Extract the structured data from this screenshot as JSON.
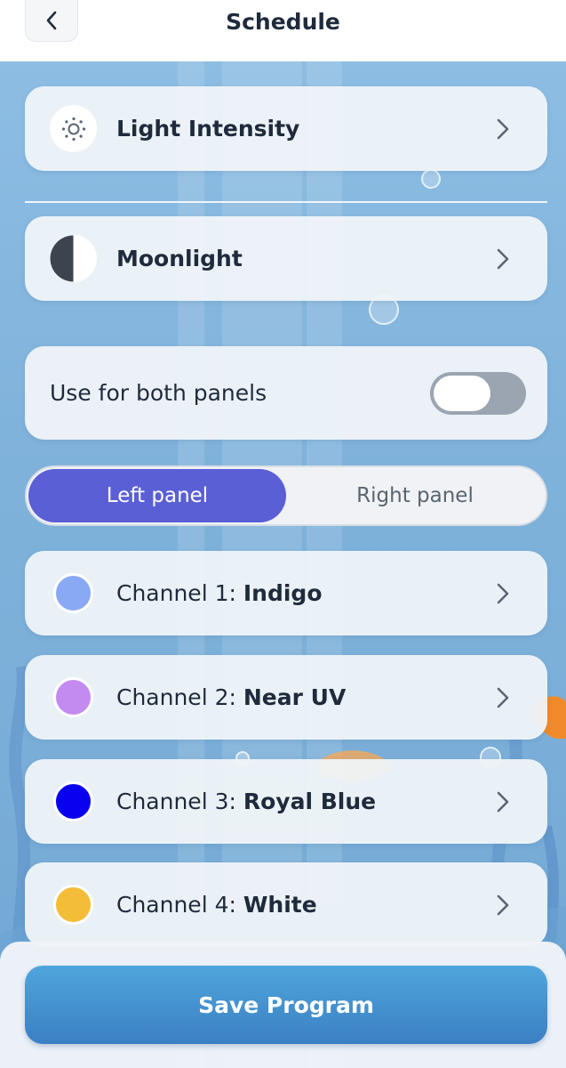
{
  "header": {
    "title": "Schedule",
    "back_icon": "chevron-left-icon"
  },
  "settings": {
    "light_intensity": {
      "label": "Light Intensity",
      "icon": "sun-icon"
    },
    "moonlight": {
      "label": "Moonlight",
      "icon": "half-moon-icon"
    },
    "use_both_panels": {
      "label": "Use for both panels",
      "enabled": false
    }
  },
  "panels": {
    "options": [
      "Left panel",
      "Right panel"
    ],
    "selected": "Left panel"
  },
  "channels": [
    {
      "prefix": "Channel 1: ",
      "name": "Indigo",
      "color": "#8aa9f5"
    },
    {
      "prefix": "Channel 2: ",
      "name": "Near UV",
      "color": "#c38af0"
    },
    {
      "prefix": "Channel 3: ",
      "name": "Royal Blue",
      "color": "#0a00f0"
    },
    {
      "prefix": "Channel 4: ",
      "name": "White",
      "color": "#f3bd3a"
    }
  ],
  "footer": {
    "save_label": "Save Program"
  },
  "colors": {
    "accent": "#5a5fd6",
    "save_button_top": "#4fa6dc",
    "save_button_bottom": "#3b7fc4"
  }
}
